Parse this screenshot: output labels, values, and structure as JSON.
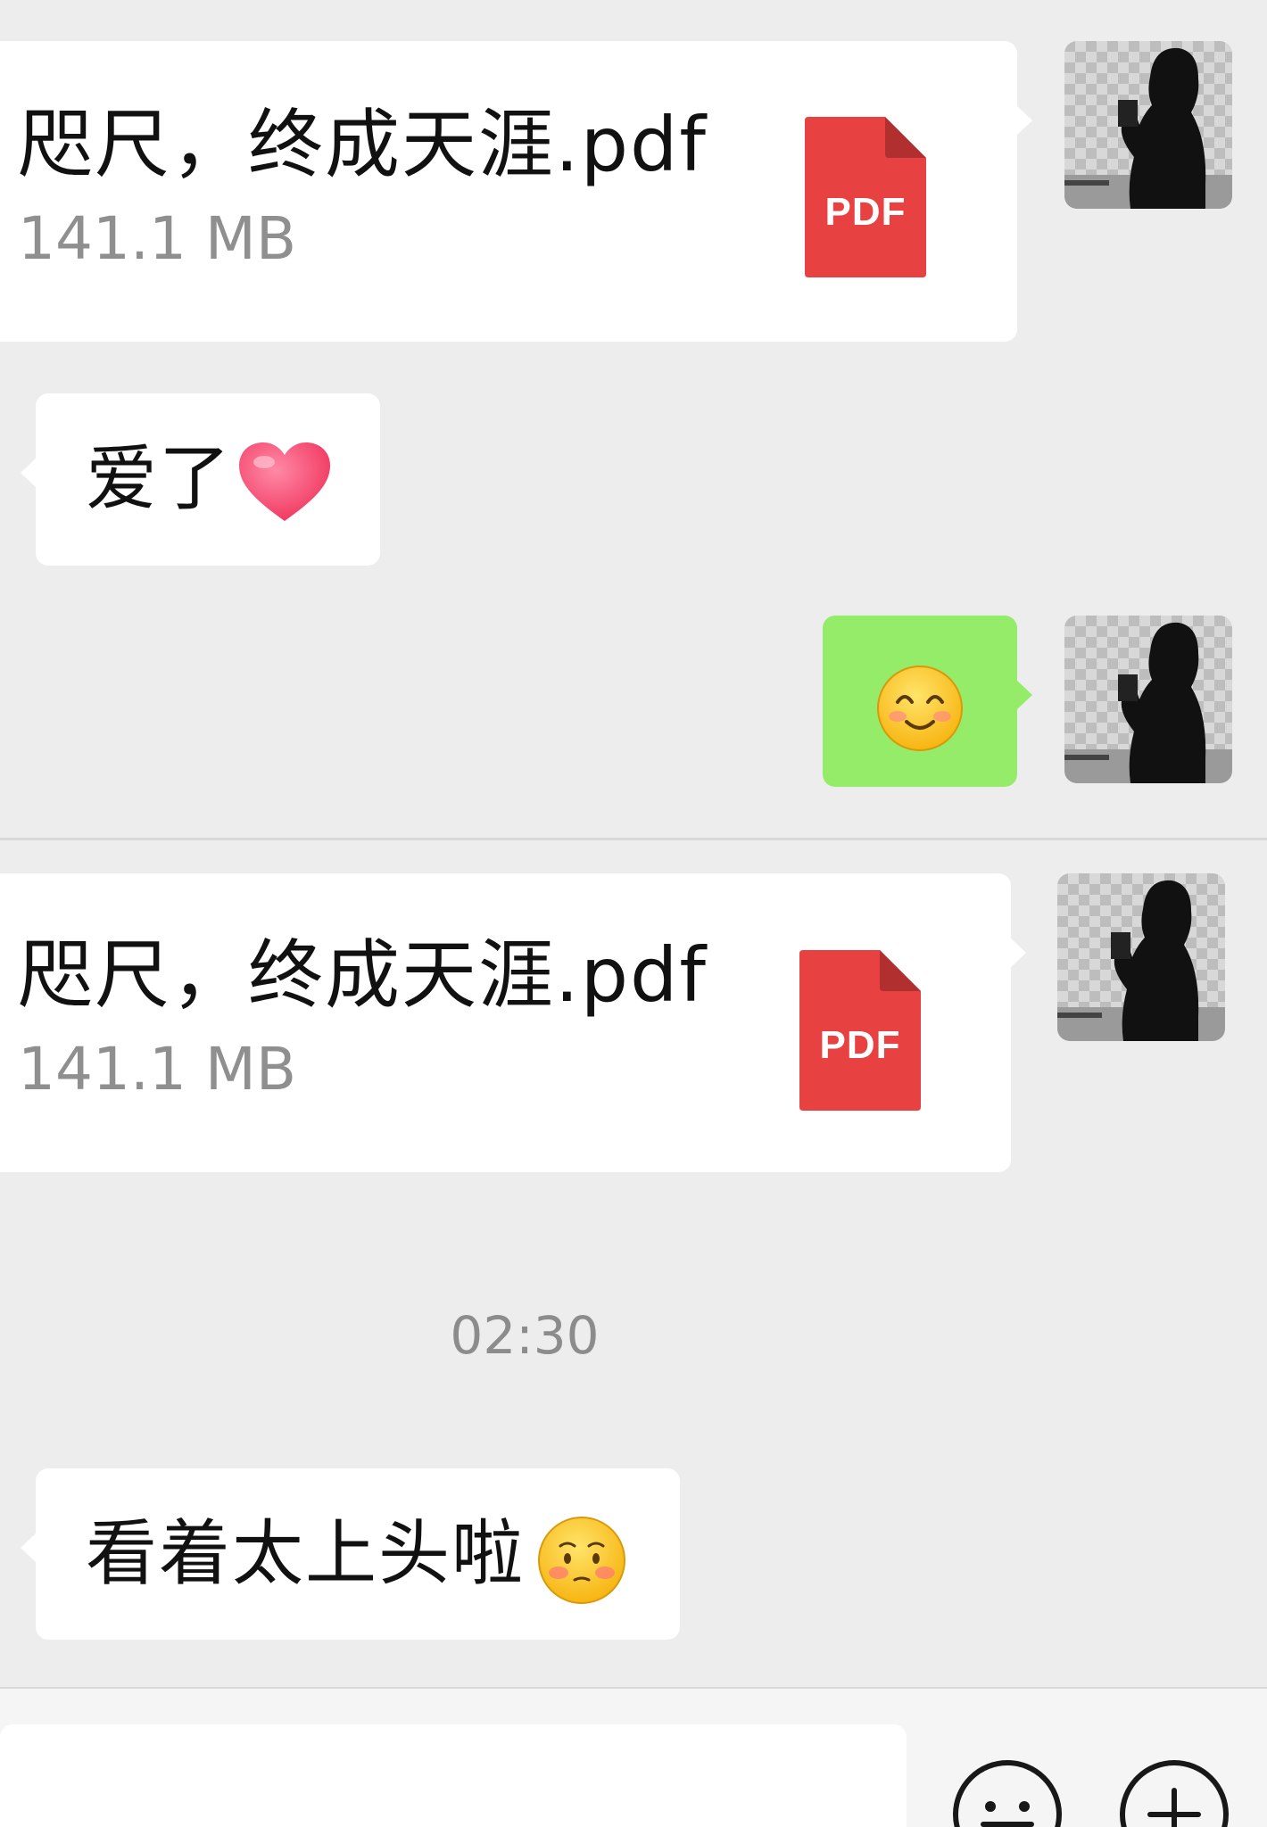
{
  "messages": [
    {
      "type": "file",
      "side": "right",
      "file_name": "咫尺，终成天涯.pdf",
      "file_size": "141.1 MB",
      "file_type_label": "PDF"
    },
    {
      "type": "text",
      "side": "left",
      "text": "爱了",
      "emoji": "heart-emoji"
    },
    {
      "type": "emoji",
      "side": "right",
      "emoji": "smiling-face-emoji"
    },
    {
      "type": "file",
      "side": "right",
      "file_name": "咫尺，终成天涯.pdf",
      "file_size": "141.1 MB",
      "file_type_label": "PDF"
    },
    {
      "type": "text",
      "side": "left",
      "text": "看着太上头啦",
      "emoji": "blushing-face-emoji"
    }
  ],
  "timestamp": "02:30",
  "input_bar": {
    "value": "",
    "buttons": [
      "emoji-icon",
      "plus-icon"
    ]
  },
  "colors": {
    "background": "#ededed",
    "incoming_bubble": "#ffffff",
    "outgoing_bubble": "#95ec69",
    "pdf_icon": "#e84142",
    "timestamp_text": "#8c8c8c"
  }
}
